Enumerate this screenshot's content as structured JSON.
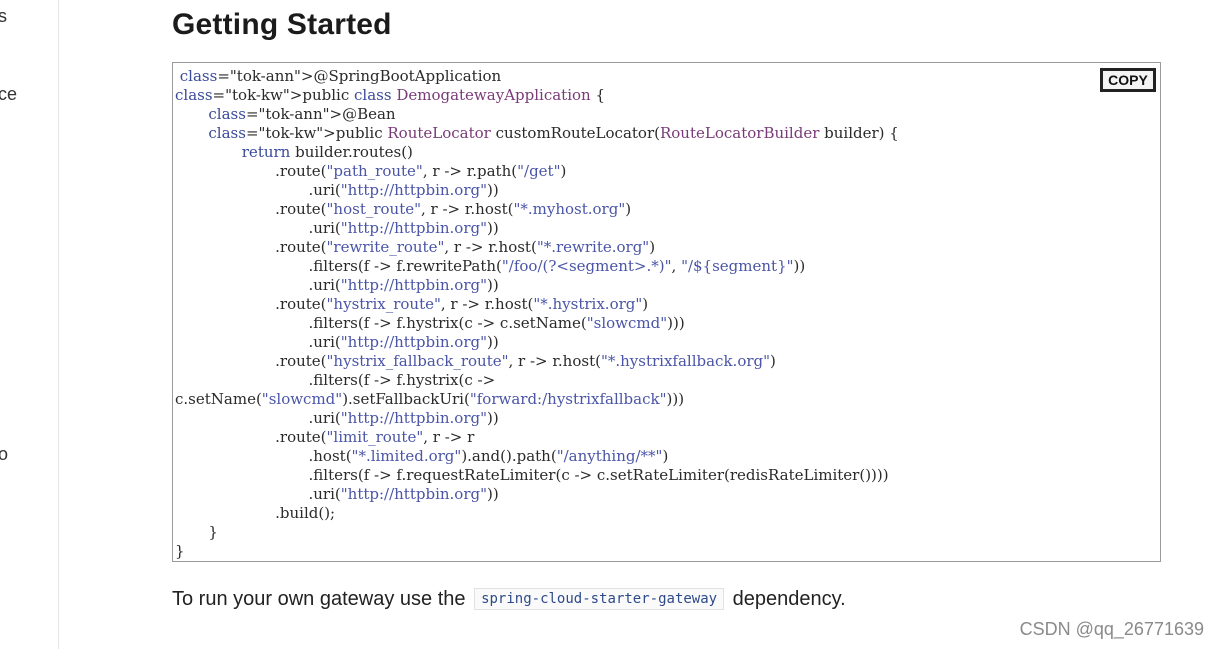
{
  "sidebar": {
    "fragments": [
      "s",
      "ce",
      "o"
    ]
  },
  "page": {
    "title": "Getting Started",
    "copy_label": "COPY",
    "desc_before": "To run your own gateway use the",
    "desc_code": "spring-cloud-starter-gateway",
    "desc_after": "dependency.",
    "watermark": "CSDN @qq_26771639"
  },
  "code_lines": [
    " @SpringBootApplication",
    "public class DemogatewayApplication {",
    "\t@Bean",
    "\tpublic RouteLocator customRouteLocator(RouteLocatorBuilder builder) {",
    "\t\treturn builder.routes()",
    "\t\t\t.route(\"path_route\", r -> r.path(\"/get\")",
    "\t\t\t\t.uri(\"http://httpbin.org\"))",
    "\t\t\t.route(\"host_route\", r -> r.host(\"*.myhost.org\")",
    "\t\t\t\t.uri(\"http://httpbin.org\"))",
    "\t\t\t.route(\"rewrite_route\", r -> r.host(\"*.rewrite.org\")",
    "\t\t\t\t.filters(f -> f.rewritePath(\"/foo/(?<segment>.*)\", \"/${segment}\"))",
    "\t\t\t\t.uri(\"http://httpbin.org\"))",
    "\t\t\t.route(\"hystrix_route\", r -> r.host(\"*.hystrix.org\")",
    "\t\t\t\t.filters(f -> f.hystrix(c -> c.setName(\"slowcmd\")))",
    "\t\t\t\t.uri(\"http://httpbin.org\"))",
    "\t\t\t.route(\"hystrix_fallback_route\", r -> r.host(\"*.hystrixfallback.org\")",
    "\t\t\t\t.filters(f -> f.hystrix(c ->",
    "c.setName(\"slowcmd\").setFallbackUri(\"forward:/hystrixfallback\")))",
    "\t\t\t\t.uri(\"http://httpbin.org\"))",
    "\t\t\t.route(\"limit_route\", r -> r",
    "\t\t\t\t.host(\"*.limited.org\").and().path(\"/anything/**\")",
    "\t\t\t\t.filters(f -> f.requestRateLimiter(c -> c.setRateLimiter(redisRateLimiter())))",
    "\t\t\t\t.uri(\"http://httpbin.org\"))",
    "\t\t\t.build();",
    "\t}",
    "}"
  ],
  "colors": {
    "annotation": "#4a7fbd",
    "keyword": "#3a4a9a",
    "type": "#7a3a78",
    "string": "#4a55a6"
  }
}
